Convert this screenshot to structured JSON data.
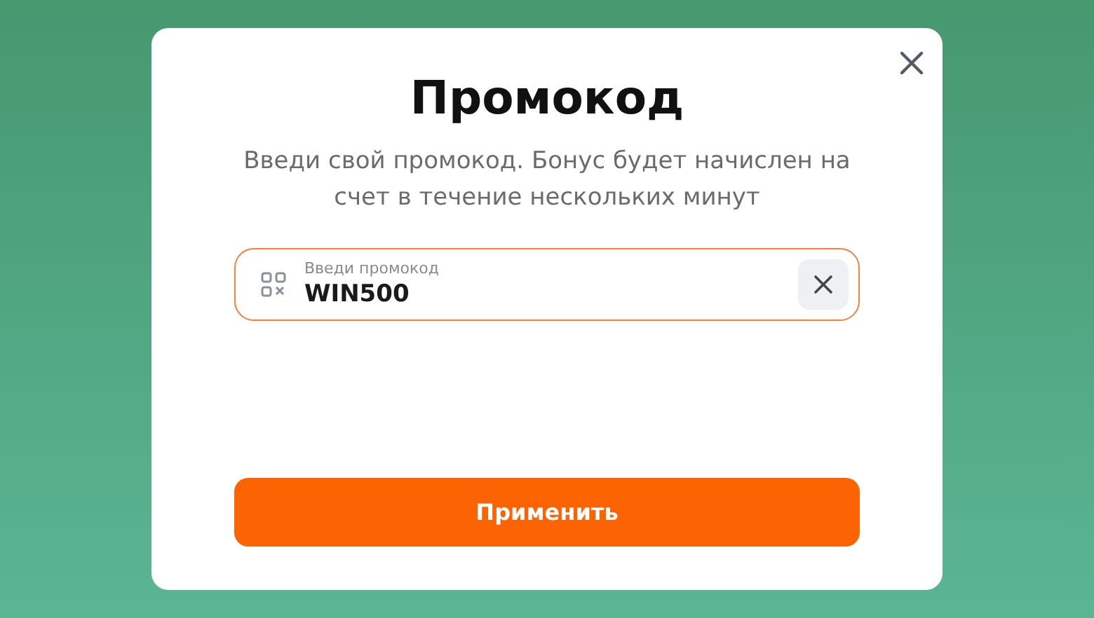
{
  "dialog": {
    "title": "Промокод",
    "description": "Введи свой промокод. Бонус будет начислен на счет в течение нескольких минут",
    "promo_field": {
      "label": "Введи промокод",
      "value": "WIN500"
    },
    "submit_button": "Применить"
  }
}
